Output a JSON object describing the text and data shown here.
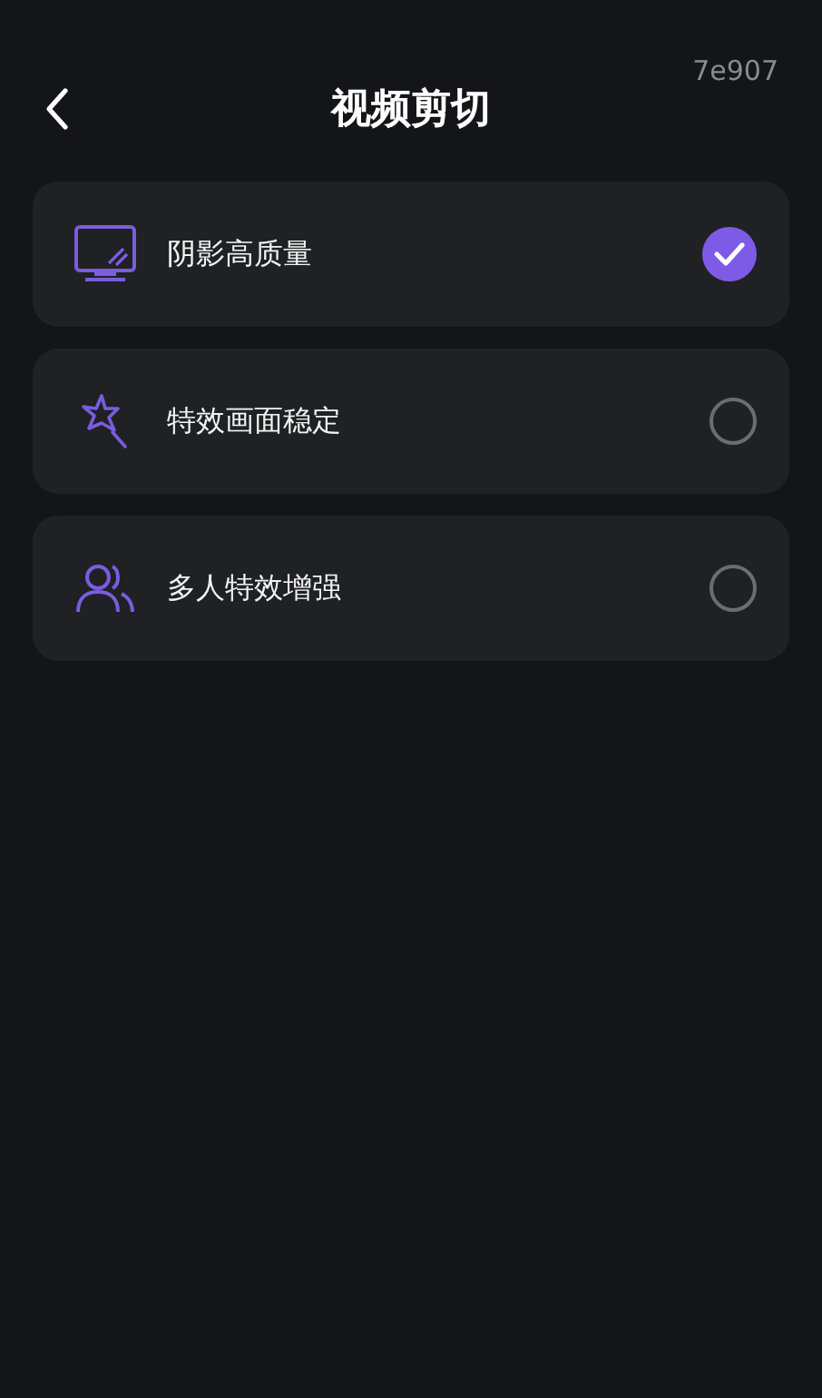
{
  "header": {
    "title": "视频剪切",
    "version": "7e907"
  },
  "options": [
    {
      "kind": "monitor",
      "label": "阴影高质量",
      "selected": true
    },
    {
      "kind": "wand",
      "label": "特效画面稳定",
      "selected": false
    },
    {
      "kind": "people",
      "label": "多人特效增强",
      "selected": false
    }
  ]
}
